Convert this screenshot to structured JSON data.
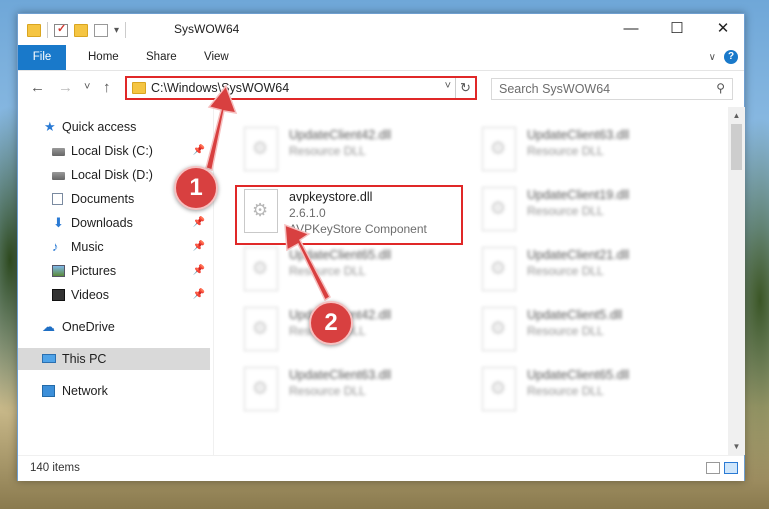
{
  "window": {
    "title": "SysWOW64",
    "minimize": "—",
    "maximize": "☐",
    "close": "✕"
  },
  "ribbon": {
    "tabs": [
      "File",
      "Home",
      "Share",
      "View"
    ],
    "expand_icon": "chevron-down-icon",
    "help_label": "?"
  },
  "nav": {
    "back": "←",
    "forward": "→",
    "recent": "˅",
    "up": "↑",
    "address": "C:\\Windows\\SysWOW64",
    "address_dropdown": "˅",
    "refresh": "↻",
    "search_placeholder": "Search SysWOW64",
    "search_icon": "⚲"
  },
  "sidebar": {
    "items": [
      {
        "label": "Quick access",
        "icon": "star-icon",
        "pinned": false
      },
      {
        "label": "Local Disk (C:)",
        "icon": "disk-icon",
        "pinned": true
      },
      {
        "label": "Local Disk (D:)",
        "icon": "disk-icon",
        "pinned": true
      },
      {
        "label": "Documents",
        "icon": "documents-icon",
        "pinned": true
      },
      {
        "label": "Downloads",
        "icon": "downloads-icon",
        "pinned": true
      },
      {
        "label": "Music",
        "icon": "music-icon",
        "pinned": true
      },
      {
        "label": "Pictures",
        "icon": "pictures-icon",
        "pinned": true
      },
      {
        "label": "Videos",
        "icon": "videos-icon",
        "pinned": true
      },
      {
        "label": "OneDrive",
        "icon": "onedrive-icon",
        "pinned": false
      },
      {
        "label": "This PC",
        "icon": "this-pc-icon",
        "pinned": false,
        "selected": true
      },
      {
        "label": "Network",
        "icon": "network-icon",
        "pinned": false
      }
    ],
    "pin_glyph": "📌"
  },
  "files": {
    "highlighted": {
      "name": "avpkeystore.dll",
      "version": "2.6.1.0",
      "description": "AVPKeyStore Component"
    },
    "left_column": [
      {
        "name": "UpdateClient42.dll",
        "type": "Resource DLL"
      },
      {
        "name": "UpdateClient65.dll",
        "type": "Resource DLL"
      },
      {
        "name": "UpdateClient42.dll",
        "type": "Resource DLL"
      },
      {
        "name": "UpdateClient63.dll",
        "type": "Resource DLL"
      }
    ],
    "right_column": [
      {
        "name": "UpdateClient63.dll",
        "type": "Resource DLL"
      },
      {
        "name": "UpdateClient19.dll",
        "type": "Resource DLL"
      },
      {
        "name": "UpdateClient21.dll",
        "type": "Resource DLL"
      },
      {
        "name": "UpdateClient5.dll",
        "type": "Resource DLL"
      },
      {
        "name": "UpdateClient65.dll",
        "type": "Resource DLL"
      }
    ]
  },
  "status": {
    "item_count": "140 items"
  },
  "annotations": {
    "callout_1": "1",
    "callout_2": "2",
    "color": "#d84040"
  }
}
